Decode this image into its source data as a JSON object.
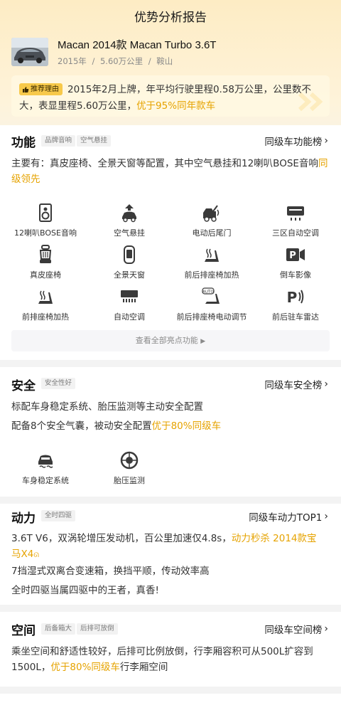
{
  "header": {
    "title": "优势分析报告"
  },
  "car": {
    "name": "Macan 2014款 Macan Turbo 3.6T",
    "year": "2015年",
    "mileage": "5.60万公里",
    "city": "鞍山",
    "sep": "/"
  },
  "recommend": {
    "badge": "推荐理由",
    "text": "2015年2月上牌，年平均行驶里程0.58万公里，公里数不大，表显里程5.60万公里，",
    "highlight": "优于95%同年款车"
  },
  "function_section": {
    "title": "功能",
    "tags": [
      "品牌音响",
      "空气悬挂"
    ],
    "rank_label": "同级车功能榜",
    "desc": "主要有：真皮座椅、全景天窗等配置，其中空气悬挂和12喇叭BOSE音响",
    "desc_highlight": "同级领先",
    "features": [
      {
        "label": "12喇叭BOSE音响",
        "icon": "speaker-icon"
      },
      {
        "label": "空气悬挂",
        "icon": "air-suspension-icon"
      },
      {
        "label": "电动后尾门",
        "icon": "power-tailgate-icon"
      },
      {
        "label": "三区自动空调",
        "icon": "tri-zone-ac-icon"
      },
      {
        "label": "真皮座椅",
        "icon": "leather-seat-icon"
      },
      {
        "label": "全景天窗",
        "icon": "panoramic-sunroof-icon"
      },
      {
        "label": "前后排座椅加热",
        "icon": "seat-heating-icon"
      },
      {
        "label": "倒车影像",
        "icon": "reverse-camera-icon"
      },
      {
        "label": "前排座椅加热",
        "icon": "front-seat-heating-icon"
      },
      {
        "label": "自动空调",
        "icon": "auto-ac-icon"
      },
      {
        "label": "前后排座椅电动调节",
        "icon": "power-seat-adjust-icon"
      },
      {
        "label": "前后驻车雷达",
        "icon": "parking-radar-icon"
      }
    ],
    "more_label": "查看全部亮点功能"
  },
  "safety_section": {
    "title": "安全",
    "tag": "安全性好",
    "rank_label": "同级车安全榜",
    "line1": "标配车身稳定系统、胎压监测等主动安全配置",
    "line2": "配备8个安全气囊，被动安全配置",
    "line2_highlight": "优于80%同级车",
    "features": [
      {
        "label": "车身稳定系统",
        "icon": "stability-control-icon"
      },
      {
        "label": "胎压监测",
        "icon": "tire-pressure-icon"
      }
    ]
  },
  "power_section": {
    "title": "动力",
    "tag": "全时四驱",
    "rank_label": "同级车动力TOP1",
    "line1": "3.6T V6，双涡轮增压发动机，百公里加速仅4.8s，",
    "line1_highlight": "动力秒杀 2014款宝马X4",
    "line2": "7挡湿式双离合变速箱，换挡平顺，传动效率高",
    "line3": "全时四驱当属四驱中的王者，真香!"
  },
  "space_section": {
    "title": "空间",
    "tags": [
      "后备箱大",
      "后排可放倒"
    ],
    "rank_label": "同级车空间榜",
    "line1": "乘坐空间和舒适性较好，后排可比例放倒，行李厢容积可从500L扩容到1500L，",
    "line1_highlight": "优于80%同级车",
    "line1_tail": "行李厢空间"
  },
  "colors": {
    "accent": "#e6a300",
    "badge": "#f7c94a",
    "icon": "#3a3a3a"
  }
}
